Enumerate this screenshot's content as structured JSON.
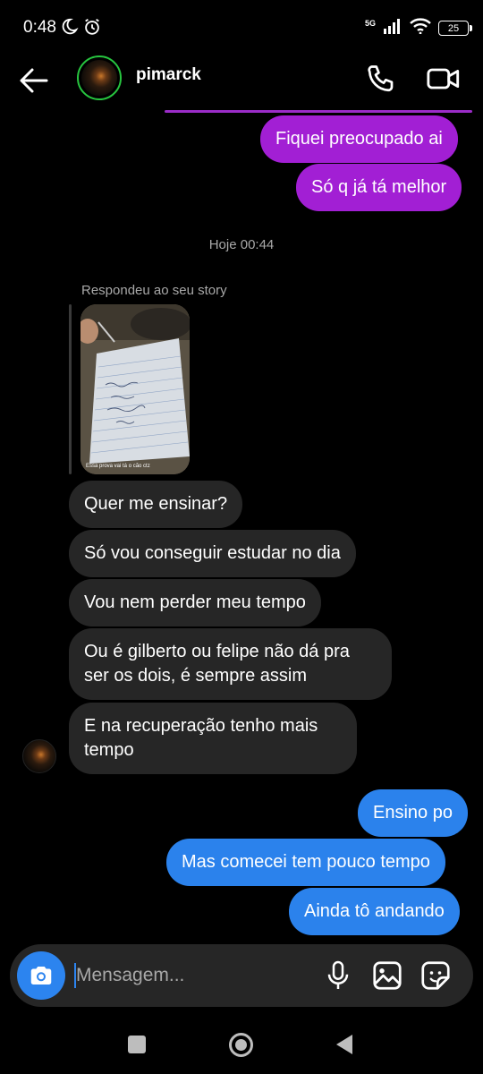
{
  "status_bar": {
    "time": "0:48",
    "network": "5G",
    "battery": "25"
  },
  "header": {
    "contact_name": "pimarck"
  },
  "messages_top": [
    {
      "text": "Fiquei preocupado ai"
    },
    {
      "text": "Só q já tá melhor"
    }
  ],
  "timestamp": "Hoje 00:44",
  "story_reply": {
    "label": "Respondeu ao seu story",
    "caption": "Essa prova vai tá o cão ctz"
  },
  "incoming": [
    {
      "text": "Quer me ensinar?"
    },
    {
      "text": "Só vou conseguir estudar no dia"
    },
    {
      "text": "Vou nem perder meu tempo"
    },
    {
      "line1": "Ou é gilberto ou felipe não dá pra",
      "line2": "ser os dois, é sempre assim"
    },
    {
      "line1": "E na recuperação tenho mais",
      "line2": "tempo"
    }
  ],
  "outgoing": [
    {
      "text": "Ensino po"
    },
    {
      "text": "Mas comecei tem pouco tempo"
    },
    {
      "text": "Ainda tô andando"
    }
  ],
  "composer": {
    "placeholder": "Mensagem..."
  },
  "colors": {
    "purple_bubble": "#a21fd4",
    "blue_bubble": "#2b82ec",
    "incoming_bubble": "#262626",
    "avatar_ring": "#27c53f"
  }
}
